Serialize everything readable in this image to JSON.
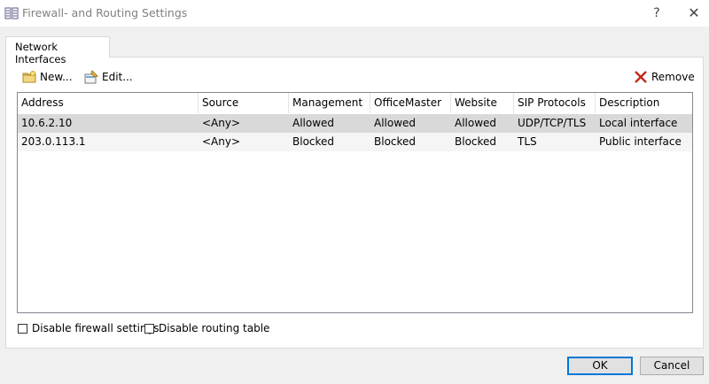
{
  "window": {
    "title": "Firewall- and Routing Settings",
    "help_glyph": "?",
    "close_glyph": "✕"
  },
  "tabs": [
    {
      "label": "Network Interfaces"
    }
  ],
  "toolbar": {
    "new_label": "New...",
    "edit_label": "Edit...",
    "remove_label": "Remove"
  },
  "table": {
    "sort_indicator": "^",
    "columns": [
      "Address",
      "Source",
      "Management",
      "OfficeMaster",
      "Website",
      "SIP Protocols",
      "Description"
    ],
    "rows": [
      [
        "10.6.2.10",
        "<Any>",
        "Allowed",
        "Allowed",
        "Allowed",
        "UDP/TCP/TLS",
        "Local interface"
      ],
      [
        "203.0.113.1",
        "<Any>",
        "Blocked",
        "Blocked",
        "Blocked",
        "TLS",
        "Public interface"
      ]
    ]
  },
  "options": {
    "disable_firewall": {
      "label": "Disable firewall settings",
      "checked": false
    },
    "disable_routing": {
      "label": "Disable routing table",
      "checked": false
    }
  },
  "buttons": {
    "ok": "OK",
    "cancel": "Cancel"
  },
  "colors": {
    "selected_row": "#d9d9d9",
    "default_button_border": "#0078d7",
    "remove_icon": "#c42b1c"
  }
}
